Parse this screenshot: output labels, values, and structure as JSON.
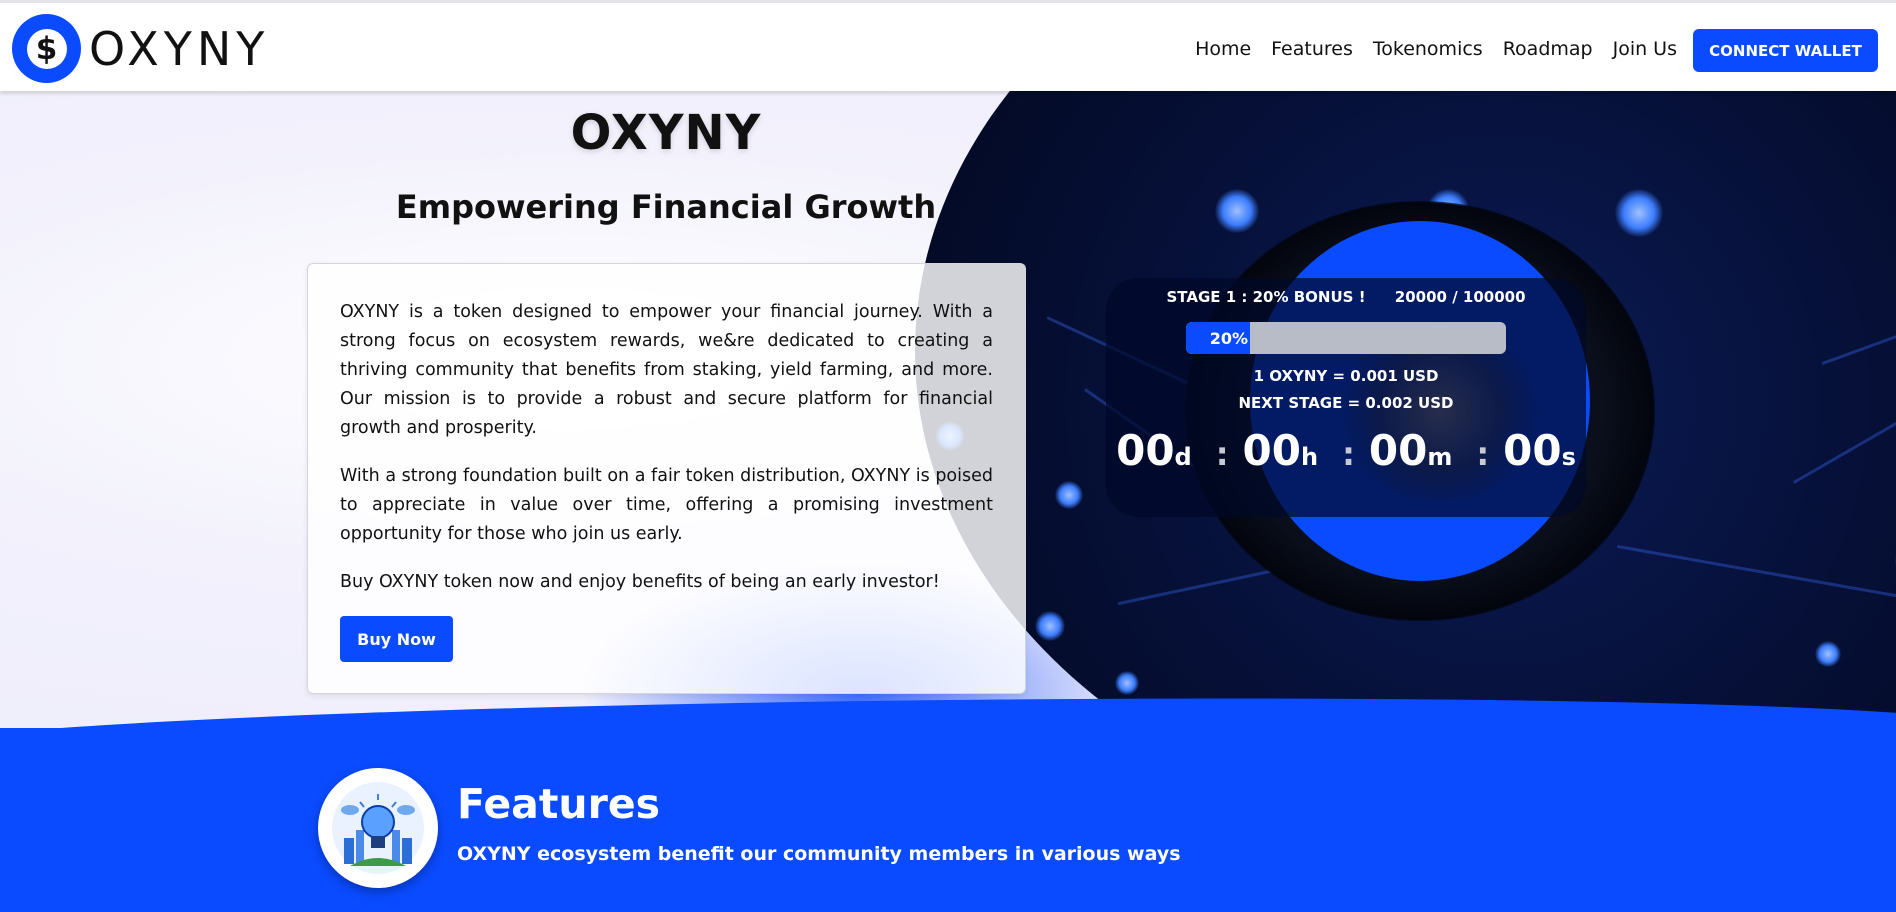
{
  "brand": {
    "name": "OXYNY",
    "logo_glyph": "$",
    "primary_color": "#0a4bff"
  },
  "nav": {
    "items": [
      {
        "label": "Home"
      },
      {
        "label": "Features"
      },
      {
        "label": "Tokenomics"
      },
      {
        "label": "Roadmap"
      },
      {
        "label": "Join Us"
      }
    ],
    "connect_label": "CONNECT WALLET"
  },
  "hero": {
    "title": "OXYNY",
    "subtitle": "Empowering Financial Growth",
    "paragraphs": [
      "OXYNY is a token designed to empower your financial journey. With a strong focus on ecosystem rewards, we&re dedicated to creating a thriving community that benefits from staking, yield farming, and more. Our mission is to provide a robust and secure platform for financial growth and prosperity.",
      "With a strong foundation built on a fair token distribution, OXYNY is poised to appreciate in value over time, offering a promising investment opportunity for those who join us early.",
      "Buy OXYNY token now and enjoy benefits of being an early investor!"
    ],
    "buy_label": "Buy Now"
  },
  "presale": {
    "stage_label": "STAGE 1 : 20% BONUS !",
    "sold_label": "20000 / 100000",
    "progress_percent": 20,
    "progress_label": "20%",
    "price_label": "1 OXYNY = 0.001 USD",
    "next_stage_label": "NEXT STAGE = 0.002 USD",
    "countdown": {
      "days": "00",
      "days_unit": "d",
      "hours": "00",
      "hours_unit": "h",
      "minutes": "00",
      "minutes_unit": "m",
      "seconds": "00",
      "seconds_unit": "s",
      "separator": ":"
    }
  },
  "features": {
    "icon": "lightbulb-icon",
    "title": "Features",
    "subtitle": "OXYNY ecosystem benefit our community members in various ways"
  }
}
